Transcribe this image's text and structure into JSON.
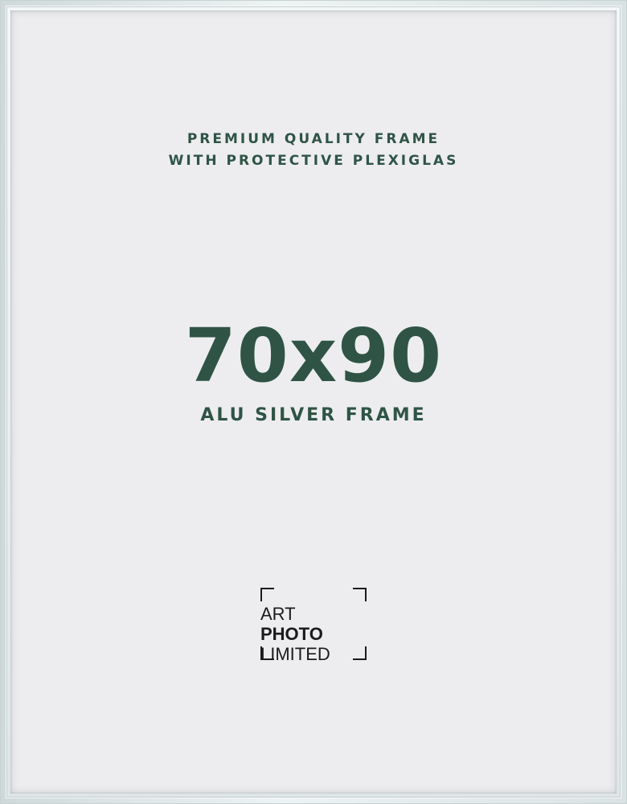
{
  "tagline": {
    "line1": "PREMIUM QUALITY FRAME",
    "line2": "WITH PROTECTIVE PLEXIGLAS"
  },
  "size": "70x90",
  "subtitle": "ALU SILVER FRAME",
  "logo": {
    "line1": "ART",
    "line2": "PHOTO",
    "line3": "LIMITED"
  },
  "colors": {
    "text_green": "#2f5446",
    "paper": "#ededef",
    "frame_silver": "#dfe6e7",
    "logo_text": "#1b1b1b"
  }
}
